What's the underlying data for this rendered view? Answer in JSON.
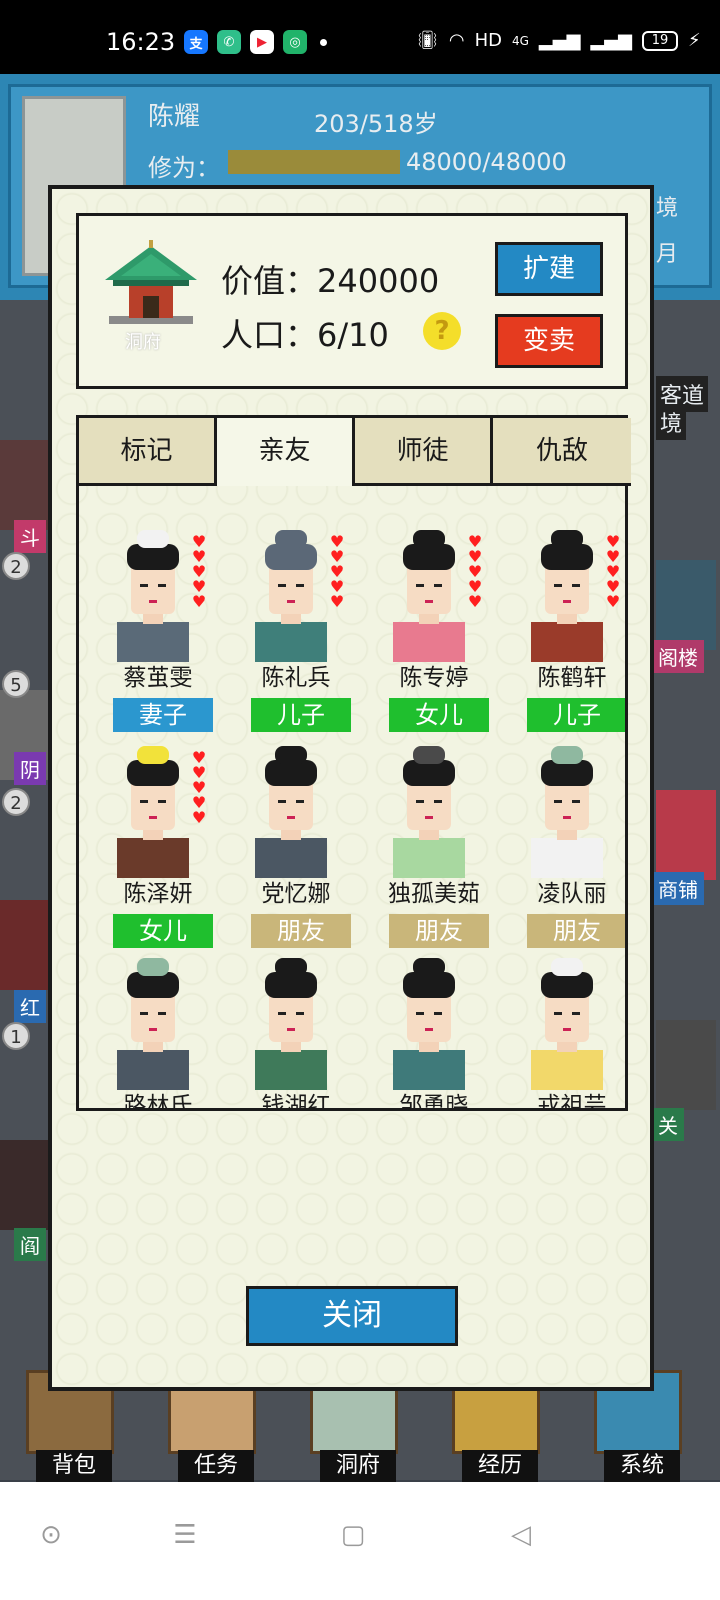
{
  "status_bar": {
    "time": "16:23",
    "network": "HD",
    "signal": "4G",
    "battery": "19"
  },
  "background": {
    "player_name": "陈耀",
    "age": "203/518岁",
    "xiuwei_label": "修为：",
    "xiuwei_value": "48000/48000",
    "side_right_1": "境",
    "side_right_2": "月",
    "side_right_3": "客道",
    "side_right_4": "境",
    "tags": [
      "斗",
      "阴",
      "红",
      "阎"
    ],
    "tags_right": [
      "阁楼",
      "商铺",
      "关"
    ],
    "badges": [
      "2",
      "5",
      "2",
      "1"
    ]
  },
  "bottom_nav": {
    "items": [
      "背包",
      "任务",
      "洞府",
      "经历",
      "系统"
    ]
  },
  "dialog": {
    "house_label": "洞府",
    "value_label": "价值：",
    "value": "240000",
    "population_label": "人口：",
    "population": "6/10",
    "help_icon": "?",
    "expand_label": "扩建",
    "sell_label": "变卖",
    "tabs": [
      "标记",
      "亲友",
      "师徒",
      "仇敌"
    ],
    "active_tab": "亲友",
    "characters": [
      {
        "name": "蔡茧雯",
        "relation": "妻子",
        "relation_color": "#2b97cf",
        "hearts": 5,
        "hair": "#1a1a1a",
        "robe": "#5a6a78",
        "crown": "#f2f2f2"
      },
      {
        "name": "陈礼兵",
        "relation": "儿子",
        "relation_color": "#1fbf2e",
        "hearts": 5,
        "hair": "#5b6877",
        "robe": "#3f7f7a",
        "crown": "#5b6877"
      },
      {
        "name": "陈专婷",
        "relation": "女儿",
        "relation_color": "#1fbf2e",
        "hearts": 5,
        "hair": "#1a1a1a",
        "robe": "#e87a8f",
        "crown": "#1a1a1a"
      },
      {
        "name": "陈鹤轩",
        "relation": "儿子",
        "relation_color": "#1fbf2e",
        "hearts": 5,
        "hair": "#1a1a1a",
        "robe": "#9a3b2a",
        "crown": "#1a1a1a"
      },
      {
        "name": "陈泽妍",
        "relation": "女儿",
        "relation_color": "#1fbf2e",
        "hearts": 5,
        "hair": "#1a1a1a",
        "robe": "#6a3a2a",
        "crown": "#f2e23a"
      },
      {
        "name": "党忆娜",
        "relation": "朋友",
        "relation_color": "#c9b67a",
        "hearts": 0,
        "hair": "#1a1a1a",
        "robe": "#4b5763",
        "crown": "#1a1a1a"
      },
      {
        "name": "独孤美茹",
        "relation": "朋友",
        "relation_color": "#c9b67a",
        "hearts": 0,
        "hair": "#1a1a1a",
        "robe": "#a8d8a0",
        "crown": "#4a4a4a"
      },
      {
        "name": "凌队丽",
        "relation": "朋友",
        "relation_color": "#c9b67a",
        "hearts": 0,
        "hair": "#1a1a1a",
        "robe": "#f2f2f2",
        "crown": "#8fb8a0"
      },
      {
        "name": "路林氏",
        "relation": "",
        "relation_color": "#c9b67a",
        "hearts": 0,
        "hair": "#1a1a1a",
        "robe": "#4b5763",
        "crown": "#8fb8a0"
      },
      {
        "name": "钱湖红",
        "relation": "",
        "relation_color": "#c9b67a",
        "hearts": 0,
        "hair": "#1a1a1a",
        "robe": "#3f7a5a",
        "crown": "#1a1a1a"
      },
      {
        "name": "邹勇晓",
        "relation": "",
        "relation_color": "#c9b67a",
        "hearts": 0,
        "hair": "#1a1a1a",
        "robe": "#3f7a7a",
        "crown": "#1a1a1a"
      },
      {
        "name": "戎祖芸",
        "relation": "",
        "relation_color": "#c9b67a",
        "hearts": 0,
        "hair": "#1a1a1a",
        "robe": "#f2d86a",
        "crown": "#f2f2f2"
      }
    ],
    "close_label": "关闭"
  }
}
